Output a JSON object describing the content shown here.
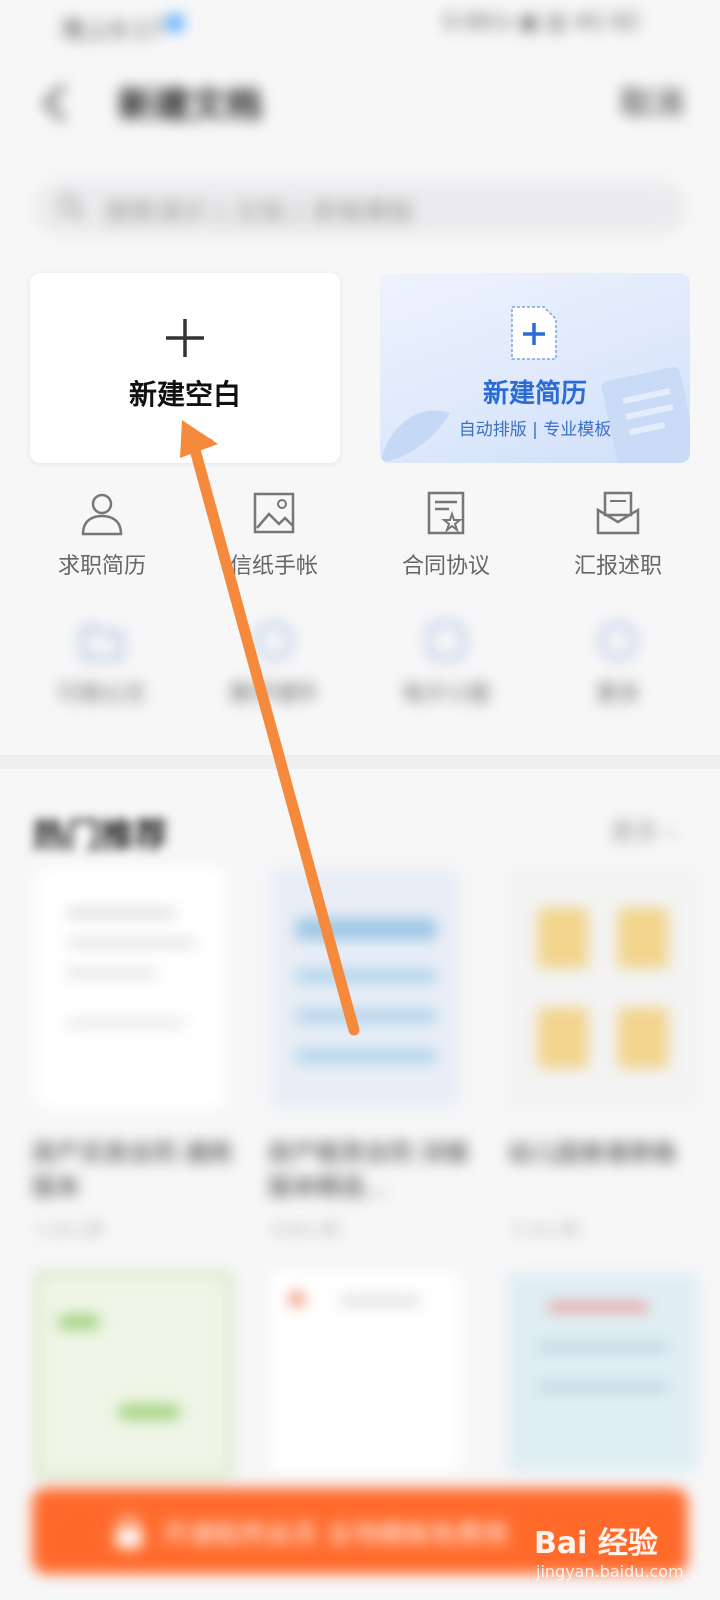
{
  "status_bar": {
    "time": "晚上9:17",
    "indicators": "0.6K/s ▣ ▥ 4G 82"
  },
  "header": {
    "title": "新建文档",
    "action": "取消"
  },
  "search": {
    "placeholder": "搜索演示 | 文档 | 表格模板"
  },
  "cards": {
    "blank": {
      "label": "新建空白",
      "icon": "plus-icon"
    },
    "resume": {
      "title": "新建简历",
      "subtitle": "自动排版 | 专业模板",
      "icon": "document-plus-icon"
    }
  },
  "categories": [
    {
      "label": "求职简历",
      "icon": "person-icon"
    },
    {
      "label": "信纸手帐",
      "icon": "image-icon"
    },
    {
      "label": "合同协议",
      "icon": "contract-star-icon"
    },
    {
      "label": "汇报述职",
      "icon": "envelope-icon"
    },
    {
      "label": "行政公文",
      "icon": "folder-icon"
    },
    {
      "label": "教学课件",
      "icon": "book-icon"
    },
    {
      "label": "电子小报",
      "icon": "newspaper-icon"
    },
    {
      "label": "更多",
      "icon": "more-icon"
    }
  ],
  "hot": {
    "title": "热门推荐",
    "more": "更多 ›",
    "templates": [
      {
        "name": "房产买卖合同 通用版本",
        "meta": "1.2k人用"
      },
      {
        "name": "房产租赁合同 详细版本精选...",
        "meta": "8.6k人用"
      },
      {
        "name": "幼儿园食谱表格 ",
        "meta": "3.1k人用"
      }
    ]
  },
  "banner": {
    "text": "开通稻壳会员 全场模板免费用",
    "icon": "lock-icon"
  },
  "watermark": {
    "brand": "Bai 经验",
    "url": "jingyan.baidu.com"
  },
  "colors": {
    "accent": "#2a6bd6",
    "banner": "#ff6a2b",
    "arrow": "#f58a3c"
  }
}
